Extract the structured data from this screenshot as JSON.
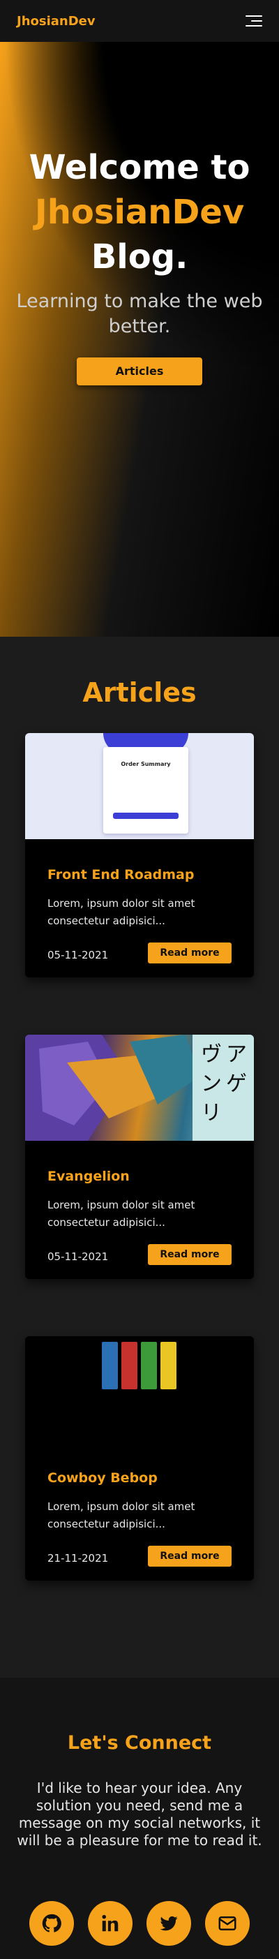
{
  "header": {
    "brand": "JhosianDev"
  },
  "hero": {
    "line1": "Welcome to",
    "line2": "JhosianDev",
    "line3": "Blog.",
    "subtitle": "Learning to make the web better.",
    "cta": "Articles"
  },
  "articles": {
    "heading": "Articles",
    "items": [
      {
        "title": "Front End Roadmap",
        "description": "Lorem, ipsum dolor sit amet consectetur adipisici...",
        "date": "05-11-2021",
        "button": "Read more",
        "thumb_text": "Order Summary"
      },
      {
        "title": "Evangelion",
        "description": "Lorem, ipsum dolor sit amet consectetur adipisici...",
        "date": "05-11-2021",
        "button": "Read more"
      },
      {
        "title": "Cowboy Bebop",
        "description": "Lorem, ipsum dolor sit amet consectetur adipisici...",
        "date": "21-11-2021",
        "button": "Read more"
      }
    ]
  },
  "connect": {
    "heading": "Let's Connect",
    "text": "I'd like to hear your idea. Any solution you need, send me a message on my social networks, it will be a pleasure for me to read it.",
    "socials": [
      "github-icon",
      "linkedin-icon",
      "twitter-icon",
      "mail-icon"
    ]
  },
  "colors": {
    "accent": "#f7a21b",
    "background": "#1c1c1c",
    "card": "#000000"
  }
}
